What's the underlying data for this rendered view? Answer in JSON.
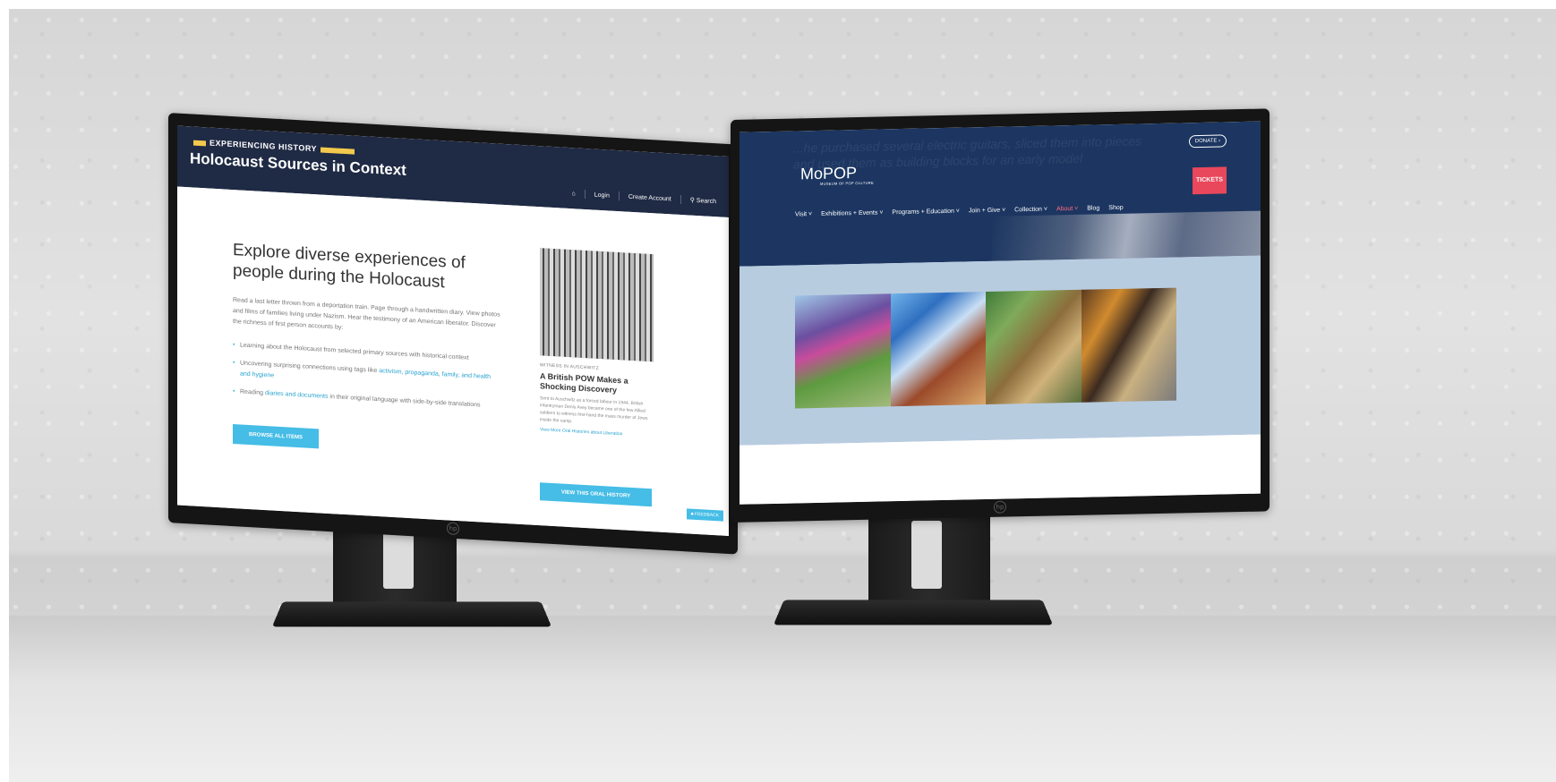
{
  "left_site": {
    "eyebrow": "EXPERIENCING HISTORY",
    "title": "Holocaust Sources in Context",
    "nav": {
      "login": "Login",
      "create_account": "Create Account",
      "search": "Search"
    },
    "heading": "Explore diverse experiences of people during the Holocaust",
    "intro": "Read a last letter thrown from a deportation train. Page through a handwritten diary. View photos and films of families living under Nazism. Hear the testimony of an American liberator. Discover the richness of first person accounts by:",
    "bullets": [
      {
        "pre": "Learning about the Holocaust from selected primary sources with historical context",
        "links": "",
        "post": ""
      },
      {
        "pre": "Uncovering surprising connections using tags like ",
        "links": "activism, propaganda, family, and health and hygiene",
        "post": ""
      },
      {
        "pre": "Reading ",
        "links": "diaries and documents",
        "post": " in their original language with side-by-side translations"
      }
    ],
    "browse_button": "BROWSE ALL ITEMS",
    "card": {
      "kicker": "WITNESS IN AUSCHWITZ",
      "title": "A British POW Makes a Shocking Discovery",
      "body": "Sent to Auschwitz as a forced labour in 1944, British infantryman Denis Avey became one of the few Allied soldiers to witness first-hand the mass murder of Jews inside the camp.",
      "link": "View More Oral Histories about Liberation"
    },
    "oral_history_button": "VIEW THIS ORAL HISTORY",
    "feedback": "FEEDBACK"
  },
  "right_site": {
    "ghost_text": "...he purchased several electric guitars, sliced them into pieces and used them as building blocks for an early model",
    "donate": "DONATE ›",
    "logo": "MoPOP",
    "logo_sub": "MUSEUM OF POP CULTURE",
    "tickets": "TICKETS",
    "nav": [
      "Visit ˅",
      "Exhibitions + Events ˅",
      "Programs + Education ˅",
      "Join + Give ˅",
      "Collection ˅",
      "About ˅",
      "Blog",
      "Shop"
    ],
    "active_nav": "About ˅"
  },
  "colors": {
    "left_header": "#1f2a44",
    "accent_yellow": "#f2c94c",
    "button_blue": "#45bde6",
    "mopop_navy": "#1c3661",
    "mopop_band": "#b8cce0",
    "tickets_red": "#e9475b"
  }
}
